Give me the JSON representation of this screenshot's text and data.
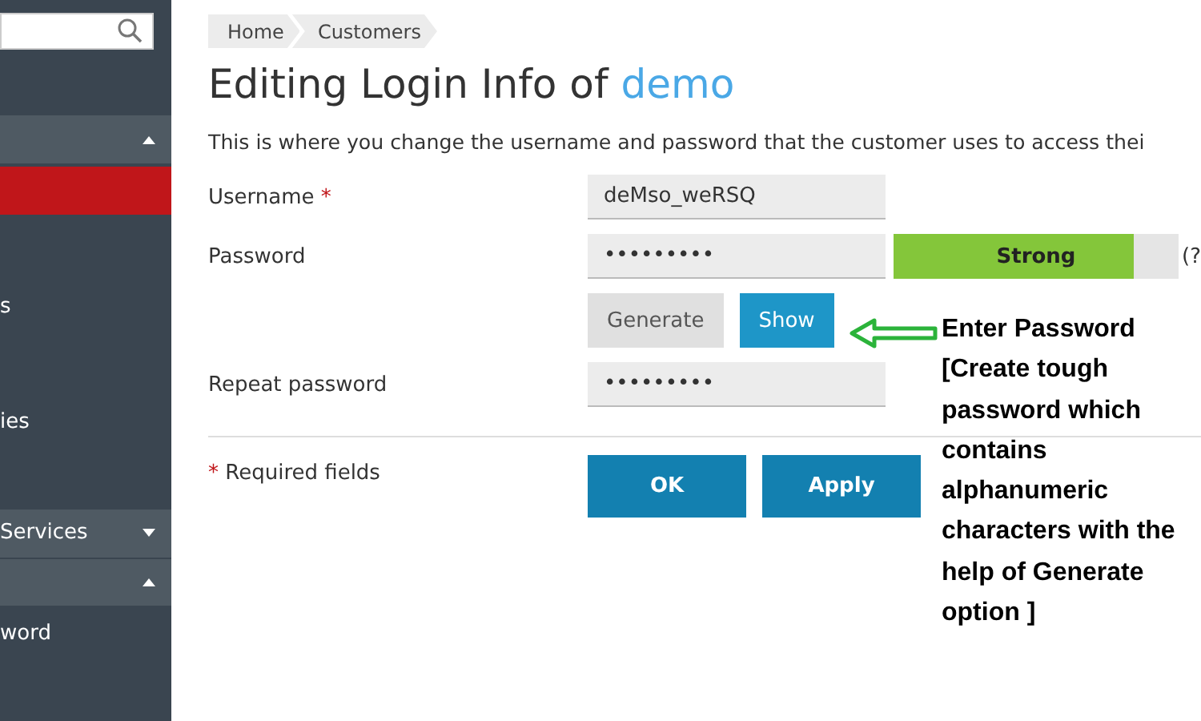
{
  "sidebar": {
    "items": [
      {
        "kind": "header",
        "expanded": true
      },
      {
        "kind": "item",
        "selected": true
      },
      {
        "kind": "item",
        "label": "s",
        "selected": false
      },
      {
        "kind": "item",
        "label": "ies",
        "selected": false
      },
      {
        "kind": "header",
        "label": "Services",
        "expanded": false
      },
      {
        "kind": "header",
        "expanded": true
      },
      {
        "kind": "item",
        "label": "word",
        "selected": false
      }
    ]
  },
  "breadcrumbs": [
    "Home",
    "Customers"
  ],
  "title": {
    "text": "Editing Login Info of ",
    "name": "demo"
  },
  "description": "This is where you change the username and password that the customer uses to access thei",
  "form": {
    "username": {
      "label": "Username",
      "required_mark": "*",
      "value": "deMso_weRSQ"
    },
    "password": {
      "label": "Password",
      "value": "•••••••••",
      "strength": {
        "label": "Strong",
        "level": 0.84
      },
      "help": "(?"
    },
    "buttons": [
      {
        "label": "Generate",
        "kind": "secondary"
      },
      {
        "label": "Show",
        "kind": "info"
      }
    ],
    "repeat": {
      "label": "Repeat password",
      "value": "•••••••••"
    },
    "required_note": {
      "mark": "*",
      "text": "Required fields"
    },
    "actions": [
      "OK",
      "Apply"
    ]
  },
  "annotation": "Enter Password [Create tough password which contains alphanumeric characters with the help of Generate option ]"
}
